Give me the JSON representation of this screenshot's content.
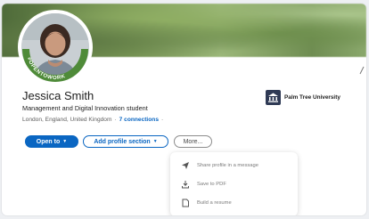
{
  "profile": {
    "name": "Jessica Smith",
    "headline": "Management and Digital Innovation student",
    "location": "London, England, United Kingdom",
    "connections_label": "7 connections",
    "open_to_work_badge": "#OPENTOWORK"
  },
  "education": {
    "university": "Palm Tree University"
  },
  "actions": {
    "open_to_label": "Open to",
    "add_section_label": "Add profile section",
    "more_label": "More..."
  },
  "more_menu": {
    "items": [
      {
        "label": "Share profile in a message",
        "icon": "send-icon"
      },
      {
        "label": "Save to PDF",
        "icon": "download-icon"
      },
      {
        "label": "Build a resume",
        "icon": "document-icon"
      }
    ]
  },
  "colors": {
    "accent": "#0a66c2",
    "open_to_work_green": "#4f8b39"
  }
}
